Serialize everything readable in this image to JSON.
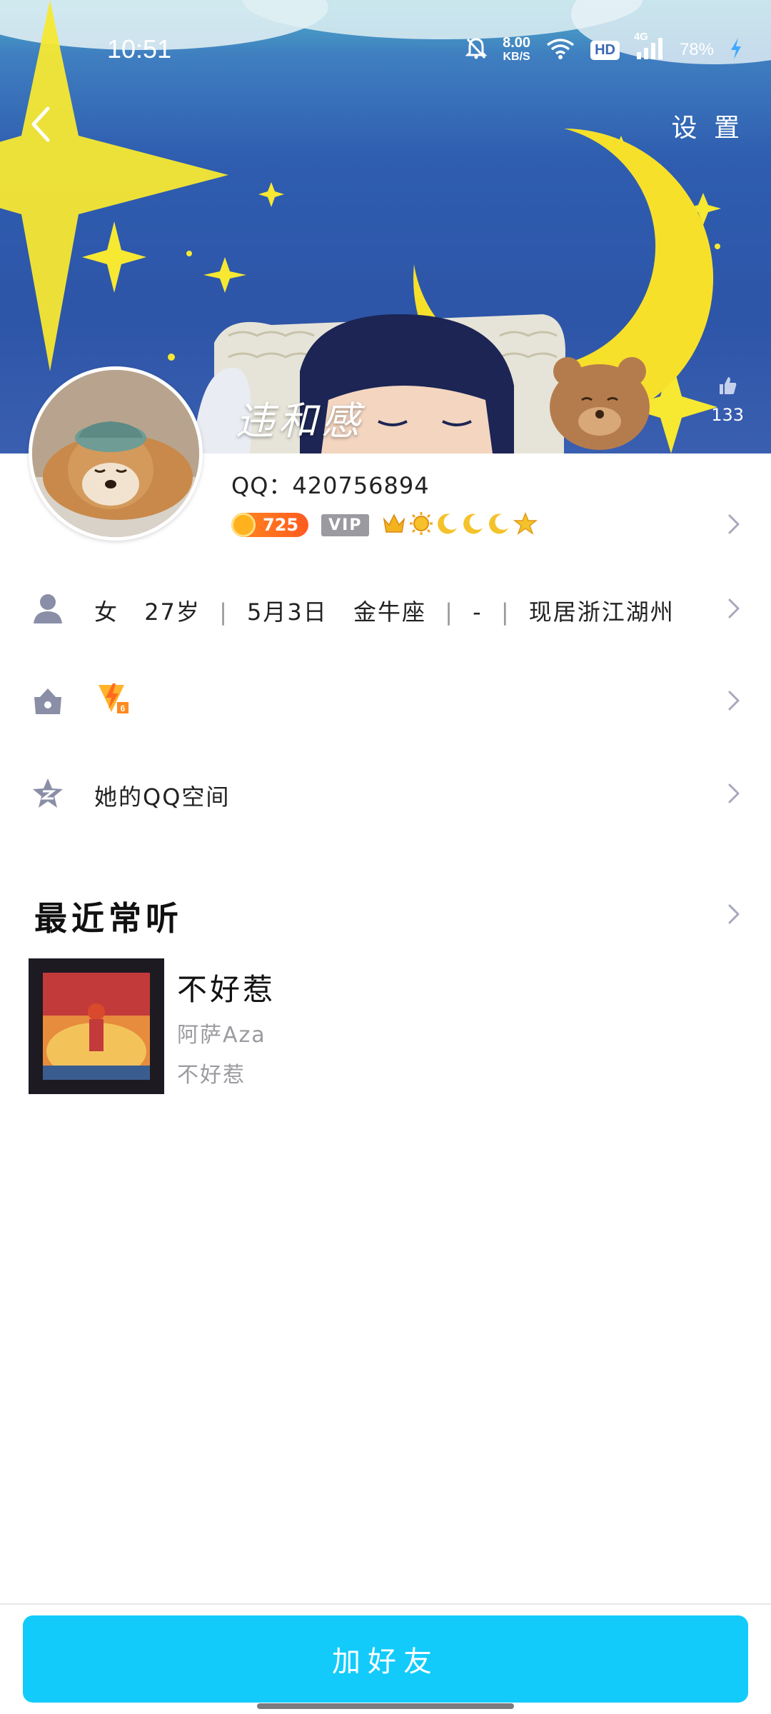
{
  "status_bar": {
    "time": "10:51",
    "net_speed_value": "8.00",
    "net_speed_unit": "KB/S",
    "hd_label": "HD",
    "signal_label": "4G",
    "battery": "78%",
    "icons": [
      "mute-bell-icon",
      "wifi-icon",
      "signal-icon",
      "charging-icon"
    ]
  },
  "header": {
    "settings_label": "设 置",
    "nickname": "违和感",
    "likes_count": "133",
    "back_icon": "chevron-left-icon"
  },
  "profile": {
    "qq_number": "QQ：420756894",
    "level_points": "725",
    "vip_label": "VIP",
    "level_icons": [
      "crown-icon",
      "sun-icon",
      "moon-icon",
      "moon-icon",
      "moon-icon",
      "star-icon"
    ]
  },
  "info_rows": {
    "basic": {
      "gender": "女",
      "age": "27岁",
      "birthday": "5月3日",
      "zodiac": "金牛座",
      "occupation": "-",
      "location": "现居浙江湖州",
      "separator": "|"
    },
    "medal_icon": "lightning-badge-icon",
    "qzone_label": "她的QQ空间"
  },
  "recent_listening": {
    "title": "最近常听",
    "songs": [
      {
        "title": "不好惹",
        "artist": "阿萨Aza",
        "album": "不好惹"
      }
    ]
  },
  "bottom": {
    "add_friend_label": "加好友"
  },
  "colors": {
    "accent": "#12cbfb",
    "level_orange": "#ff6a1f",
    "vip_gray": "#9a9aa0",
    "icon_gray": "#8a8ea6"
  }
}
